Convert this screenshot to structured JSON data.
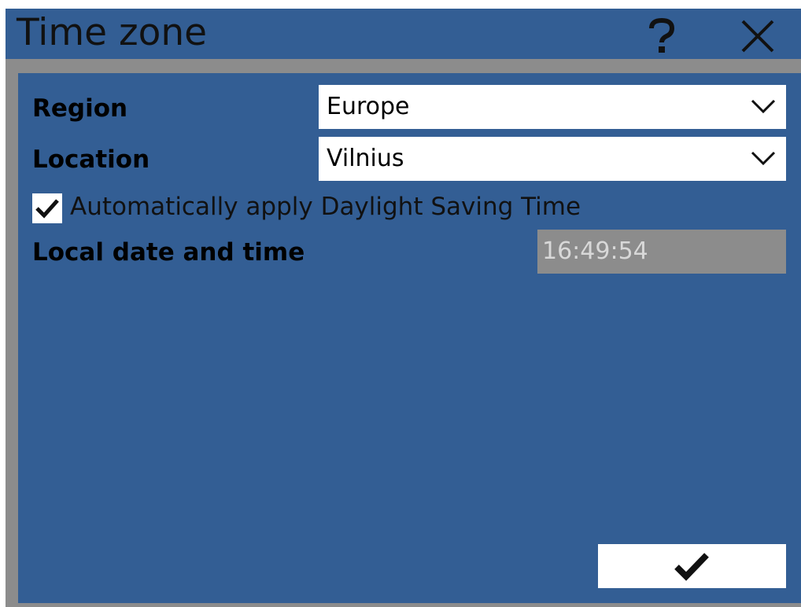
{
  "dialog": {
    "title": "Time zone",
    "help_icon": "question-mark-icon",
    "close_icon": "close-x-icon"
  },
  "form": {
    "region": {
      "label": "Region",
      "value": "Europe"
    },
    "location": {
      "label": "Location",
      "value": "Vilnius"
    },
    "dst": {
      "label": "Automatically apply Daylight Saving Time",
      "checked": true
    },
    "local_time": {
      "label": "Local date and time",
      "value": "16:49:54"
    }
  },
  "footer": {
    "ok_icon": "checkmark-icon"
  },
  "colors": {
    "panel": "#335e94",
    "frame": "#8c8c8c",
    "field": "#ffffff",
    "disabled_field": "#8c8c8c"
  }
}
